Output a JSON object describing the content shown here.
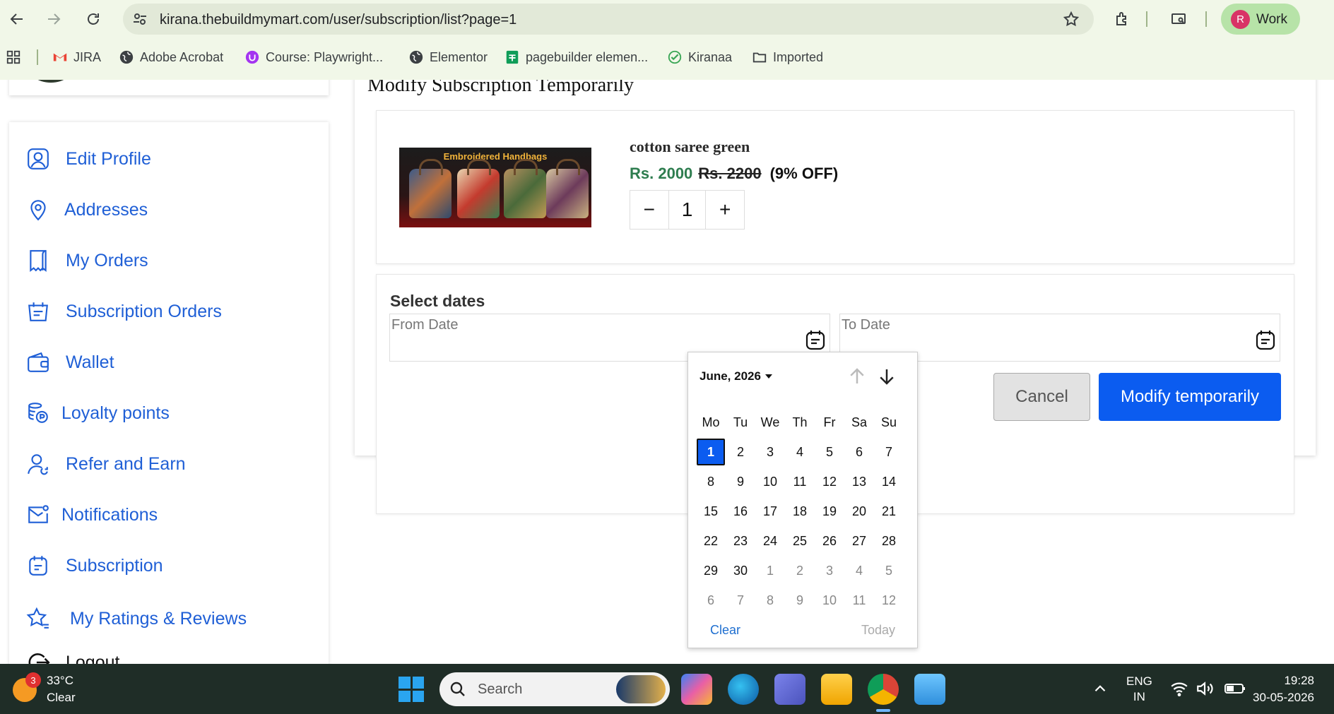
{
  "browser": {
    "url": "kirana.thebuildmymart.com/user/subscription/list?page=1",
    "profile_initial": "R",
    "profile_name": "Work",
    "bookmarks": [
      {
        "label": "JIRA",
        "icon": "gmail-icon"
      },
      {
        "label": "Adobe Acrobat",
        "icon": "globe-icon"
      },
      {
        "label": "Course: Playwright...",
        "icon": "udemy-icon"
      },
      {
        "label": "Elementor",
        "icon": "globe-icon"
      },
      {
        "label": "pagebuilder elemen...",
        "icon": "sheets-icon"
      },
      {
        "label": "Kiranaa",
        "icon": "check-circle-icon"
      },
      {
        "label": "Imported",
        "icon": "folder-icon"
      }
    ]
  },
  "sidebar": {
    "items": [
      {
        "label": "Edit Profile",
        "icon": "user-icon"
      },
      {
        "label": "Addresses",
        "icon": "location-icon"
      },
      {
        "label": "My Orders",
        "icon": "receipt-icon"
      },
      {
        "label": "Subscription Orders",
        "icon": "calendar-list-icon"
      },
      {
        "label": "Wallet",
        "icon": "wallet-icon"
      },
      {
        "label": "Loyalty points",
        "icon": "coins-icon"
      },
      {
        "label": "Refer and Earn",
        "icon": "user-refer-icon"
      },
      {
        "label": "Notifications",
        "icon": "mail-icon"
      },
      {
        "label": "Subscription",
        "icon": "calendar-icon"
      },
      {
        "label": "My Ratings & Reviews",
        "icon": "star-icon"
      },
      {
        "label": "Logout",
        "icon": "logout-icon"
      }
    ]
  },
  "main": {
    "title": "Modify Subscription Temporarily",
    "product": {
      "image_caption": "Embroidered Handbags",
      "name": "cotton saree green",
      "price": "Rs. 2000",
      "mrp": "Rs. 2200",
      "discount": "(9% OFF)",
      "quantity": "1",
      "minus": "−",
      "plus": "+"
    },
    "dates": {
      "title": "Select dates",
      "from_placeholder": "From Date",
      "to_placeholder": "To Date",
      "cancel_label": "Cancel",
      "modify_label": "Modify temporarily"
    }
  },
  "datepicker": {
    "month_label": "June, 2026",
    "weekdays": [
      "Mo",
      "Tu",
      "We",
      "Th",
      "Fr",
      "Sa",
      "Su"
    ],
    "weeks": [
      [
        {
          "d": "1",
          "sel": true
        },
        {
          "d": "2"
        },
        {
          "d": "3"
        },
        {
          "d": "4"
        },
        {
          "d": "5"
        },
        {
          "d": "6"
        },
        {
          "d": "7"
        }
      ],
      [
        {
          "d": "8"
        },
        {
          "d": "9"
        },
        {
          "d": "10"
        },
        {
          "d": "11"
        },
        {
          "d": "12"
        },
        {
          "d": "13"
        },
        {
          "d": "14"
        }
      ],
      [
        {
          "d": "15"
        },
        {
          "d": "16"
        },
        {
          "d": "17"
        },
        {
          "d": "18"
        },
        {
          "d": "19"
        },
        {
          "d": "20"
        },
        {
          "d": "21"
        }
      ],
      [
        {
          "d": "22"
        },
        {
          "d": "23"
        },
        {
          "d": "24"
        },
        {
          "d": "25"
        },
        {
          "d": "26"
        },
        {
          "d": "27"
        },
        {
          "d": "28"
        }
      ],
      [
        {
          "d": "29"
        },
        {
          "d": "30"
        },
        {
          "d": "1",
          "other": true
        },
        {
          "d": "2",
          "other": true
        },
        {
          "d": "3",
          "other": true
        },
        {
          "d": "4",
          "other": true
        },
        {
          "d": "5",
          "other": true
        }
      ],
      [
        {
          "d": "6",
          "other": true
        },
        {
          "d": "7",
          "other": true
        },
        {
          "d": "8",
          "other": true
        },
        {
          "d": "9",
          "other": true
        },
        {
          "d": "10",
          "other": true
        },
        {
          "d": "11",
          "other": true
        },
        {
          "d": "12",
          "other": true
        }
      ]
    ],
    "clear_label": "Clear",
    "today_label": "Today"
  },
  "taskbar": {
    "weather_badge": "3",
    "temperature": "33°C",
    "condition": "Clear",
    "search_label": "Search",
    "lang_top": "ENG",
    "lang_bottom": "IN",
    "time": "19:28",
    "date": "30-05-2026"
  },
  "colors": {
    "link_blue": "#1f5fd6",
    "primary_button": "#0b5cf0",
    "price_green": "#2e7d4f",
    "chrome_bg": "#f1f7e8",
    "taskbar_bg": "#1f2d27"
  }
}
